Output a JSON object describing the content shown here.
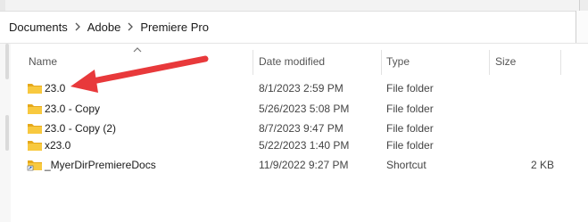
{
  "breadcrumb": {
    "items": [
      "Documents",
      "Adobe",
      "Premiere Pro"
    ]
  },
  "columns": {
    "name": "Name",
    "date_modified": "Date modified",
    "type": "Type",
    "size": "Size"
  },
  "files": [
    {
      "name": "23.0",
      "date": "8/1/2023 2:59 PM",
      "type": "File folder",
      "size": "",
      "icon": "folder-icon"
    },
    {
      "name": "23.0 - Copy",
      "date": "5/26/2023 5:08 PM",
      "type": "File folder",
      "size": "",
      "icon": "folder-icon"
    },
    {
      "name": "23.0 - Copy (2)",
      "date": "8/7/2023 9:47 PM",
      "type": "File folder",
      "size": "",
      "icon": "folder-icon"
    },
    {
      "name": "x23.0",
      "date": "5/22/2023 1:40 PM",
      "type": "File folder",
      "size": "",
      "icon": "folder-icon"
    },
    {
      "name": "_MyerDirPremiereDocs",
      "date": "11/9/2022 9:27 PM",
      "type": "Shortcut",
      "size": "2 KB",
      "icon": "folder-shortcut-icon"
    }
  ],
  "colors": {
    "folder_body": "#f8c93f",
    "folder_tab": "#e6a91b",
    "annotation_arrow": "#e8393b"
  }
}
